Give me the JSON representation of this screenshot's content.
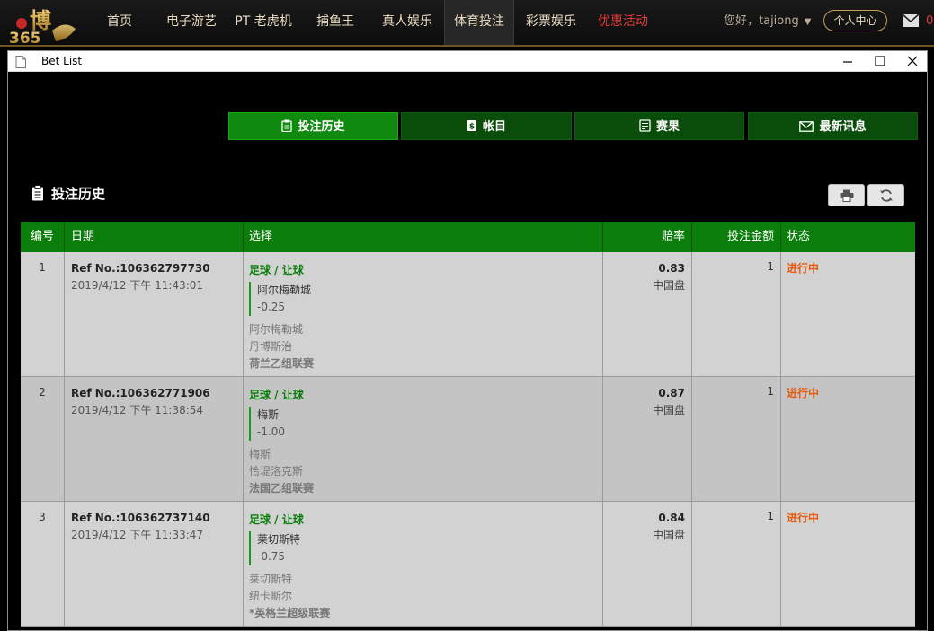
{
  "nav": {
    "items": [
      "首页",
      "电子游艺",
      "PT 老虎机",
      "捕鱼王",
      "真人娱乐",
      "体育投注",
      "彩票娱乐",
      "优惠活动"
    ],
    "greeting": "您好，tajiong",
    "user_center": "个人中心",
    "mail_count": "0",
    "colors": {
      "accent": "#c7a25a",
      "promo": "#e33b3b"
    }
  },
  "window": {
    "title": "Bet List",
    "controls": [
      "minimize-icon",
      "maximize-icon",
      "close-icon"
    ]
  },
  "tabs": [
    {
      "label": "投注历史",
      "icon": "clipboard-icon",
      "active": true
    },
    {
      "label": "帐目",
      "icon": "ledger-icon",
      "active": false
    },
    {
      "label": "赛果",
      "icon": "results-icon",
      "active": false
    },
    {
      "label": "最新讯息",
      "icon": "envelope-icon",
      "active": false
    }
  ],
  "section": {
    "title": "投注历史",
    "tools": [
      "print-icon",
      "refresh-icon"
    ]
  },
  "table": {
    "headers": [
      "编号",
      "日期",
      "选择",
      "赔率",
      "投注金额",
      "状态"
    ],
    "rows": [
      {
        "no": "1",
        "ref": "Ref No.:106362797730",
        "date": "2019/4/12 下午 11:43:01",
        "sport": "足球 / 让球",
        "pick": "阿尔梅勒城",
        "handicap": "-0.25",
        "home": "阿尔梅勒城",
        "away": "丹博斯治",
        "league": "荷兰乙组联赛",
        "odds": "0.83",
        "market": "中国盘",
        "amount": "1",
        "status": "进行中"
      },
      {
        "no": "2",
        "ref": "Ref No.:106362771906",
        "date": "2019/4/12 下午 11:38:54",
        "sport": "足球 / 让球",
        "pick": "梅斯",
        "handicap": "-1.00",
        "home": "梅斯",
        "away": "恰堤洛克斯",
        "league": "法国乙组联赛",
        "odds": "0.87",
        "market": "中国盘",
        "amount": "1",
        "status": "进行中"
      },
      {
        "no": "3",
        "ref": "Ref No.:106362737140",
        "date": "2019/4/12 下午 11:33:47",
        "sport": "足球 / 让球",
        "pick": "莱切斯特",
        "handicap": "-0.75",
        "home": "莱切斯特",
        "away": "纽卡斯尔",
        "league": "*英格兰超级联赛",
        "odds": "0.84",
        "market": "中国盘",
        "amount": "1",
        "status": "进行中"
      }
    ]
  }
}
